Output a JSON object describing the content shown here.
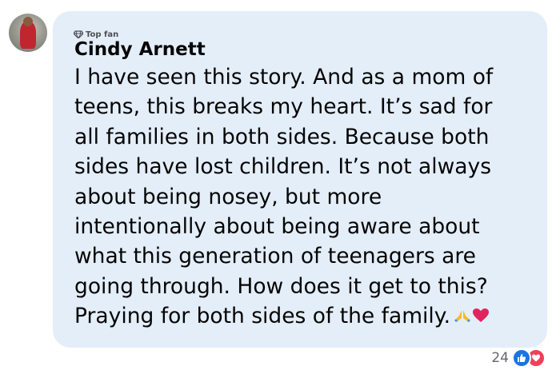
{
  "comment": {
    "badge_label": "Top fan",
    "author": "Cindy Arnett",
    "lines": [
      "I have seen this story. And as a mom of",
      "teens, this breaks my heart. It’s sad for",
      "all families in both sides. Because both",
      "sides have lost children. It’s not always",
      "about being nosey, but more",
      "intentionally about being aware about",
      "what this generation of teenagers are",
      "going through. How does it get to this?",
      "Praying for both sides of the family."
    ],
    "emojis": [
      "praying-hands-icon",
      "red-heart-icon"
    ]
  },
  "reactions": {
    "count": "24",
    "icons": [
      "like-icon",
      "love-icon"
    ],
    "like_color": "#1b74e4",
    "love_color": "#f33e58"
  },
  "colors": {
    "bubble": "#e4eef9",
    "text": "#050505",
    "muted": "#65676b"
  }
}
